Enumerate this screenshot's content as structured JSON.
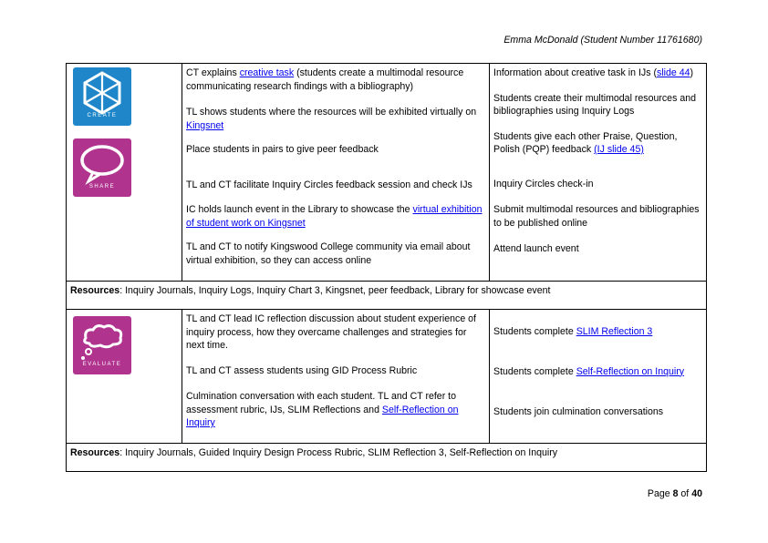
{
  "header": {
    "author": "Emma McDonald (Student Number 11761680)"
  },
  "icons": {
    "create_label": "CREATE",
    "share_label": "SHARE",
    "evaluate_label": "EVALUATE",
    "create_color": "#1f87c9",
    "share_color": "#b0338e",
    "evaluate_color": "#b0338e"
  },
  "row1": {
    "mid": {
      "p1_pre": "CT explains ",
      "p1_link": "creative task",
      "p1_post": " (students create a multimodal resource communicating research findings with a bibliography)",
      "p2_pre": "TL shows students where the resources will be exhibited virtually on ",
      "p2_link": "Kingsnet",
      "p3": "Place students in pairs to give peer feedback",
      "p4": "TL and CT facilitate Inquiry Circles feedback session and check IJs",
      "p5_pre": "IC holds launch event in the Library to showcase the ",
      "p5_link": "virtual exhibition of student work on Kingsnet",
      "p6": "TL and CT to notify Kingswood College community via email about virtual exhibition, so they can access online"
    },
    "right": {
      "p1_pre": "Information about creative task in IJs (",
      "p1_link": "slide 44",
      "p1_post": ")",
      "p2": "Students create their multimodal resources and bibliographies using Inquiry Logs",
      "p3_pre": "Students give each other Praise, Question, Polish (PQP) feedback ",
      "p3_link": "(IJ slide 45)",
      "p4": "Inquiry Circles check-in",
      "p5": "Submit multimodal resources and bibliographies to be published online",
      "p6": "Attend launch event"
    },
    "resources_label": "Resources",
    "resources_text": ": Inquiry Journals, Inquiry Logs, Inquiry Chart 3, Kingsnet, peer feedback, Library for showcase event"
  },
  "row2": {
    "mid": {
      "p1": "TL and CT lead IC reflection discussion about student experience of inquiry process, how they overcame challenges and strategies for next time.",
      "p2": "TL and CT assess students using GID Process Rubric",
      "p3_pre": "Culmination conversation with each student. TL and CT refer to assessment rubric, IJs, SLIM Reflections and ",
      "p3_link": "Self-Reflection on Inquiry"
    },
    "right": {
      "p1_pre": "Students complete ",
      "p1_link": "SLIM Reflection 3",
      "p2_pre": "Students complete ",
      "p2_link": "Self-Reflection on Inquiry",
      "p3": "Students join culmination conversations"
    },
    "resources_label": "Resources",
    "resources_text": ": Inquiry Journals, Guided Inquiry Design Process Rubric, SLIM Reflection 3, Self-Reflection on Inquiry"
  },
  "footer": {
    "prefix": "Page ",
    "page": "8",
    "middle": " of ",
    "total": "40"
  }
}
